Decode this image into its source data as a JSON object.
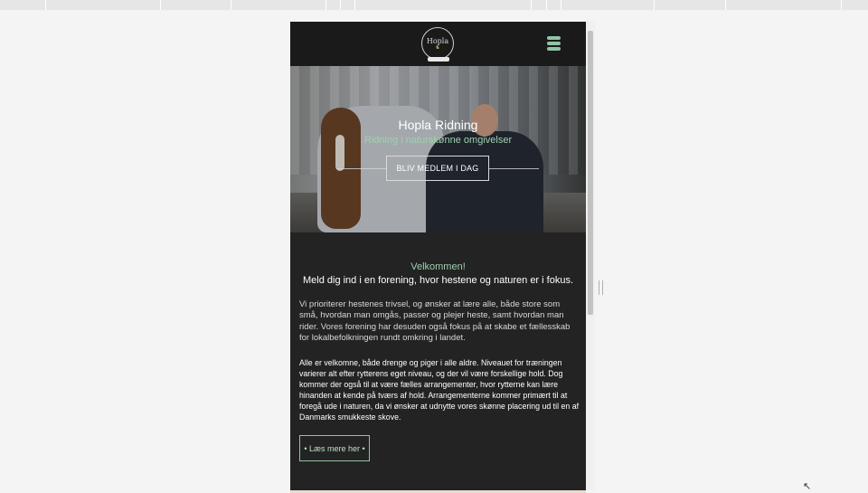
{
  "header": {
    "logo_text": "Hopla",
    "menu_icon": "hamburger-menu-icon"
  },
  "hero": {
    "title": "Hopla Ridning",
    "subtitle": "Ridning i naturskønne omgivelser",
    "cta_label": "BLIV MEDLEM I DAG"
  },
  "content": {
    "welcome": "Velkommen!",
    "welcome_sub": "Meld dig ind i en forening, hvor hestene og naturen er i fokus.",
    "paragraph1": "Vi prioriterer hestenes trivsel, og ønsker at lære alle, både store som små, hvordan man omgås, passer og plejer heste, samt hvordan man rider. Vores forening har desuden også fokus på at skabe et fællesskab for lokalbefolkningen rundt omkring i landet.",
    "paragraph2": "Alle er velkomne, både drenge og piger i alle aldre. Niveauet for træningen varierer alt efter rytterens eget niveau, og der vil være forskellige hold. Dog kommer der også til at være fælles arrangementer, hvor rytterne kan lære hinanden at kende på tværs af hold. Arrangementerne kommer primært til at foregå ude i naturen, da vi ønsker at udnytte vores skønne placering ud til en af Danmarks smukkeste skove.",
    "read_more_label": "• Læs mere her •"
  },
  "colors": {
    "accent_green": "#8fc4a4",
    "header_bg": "#1a1a1a",
    "content_bg": "#232323"
  }
}
